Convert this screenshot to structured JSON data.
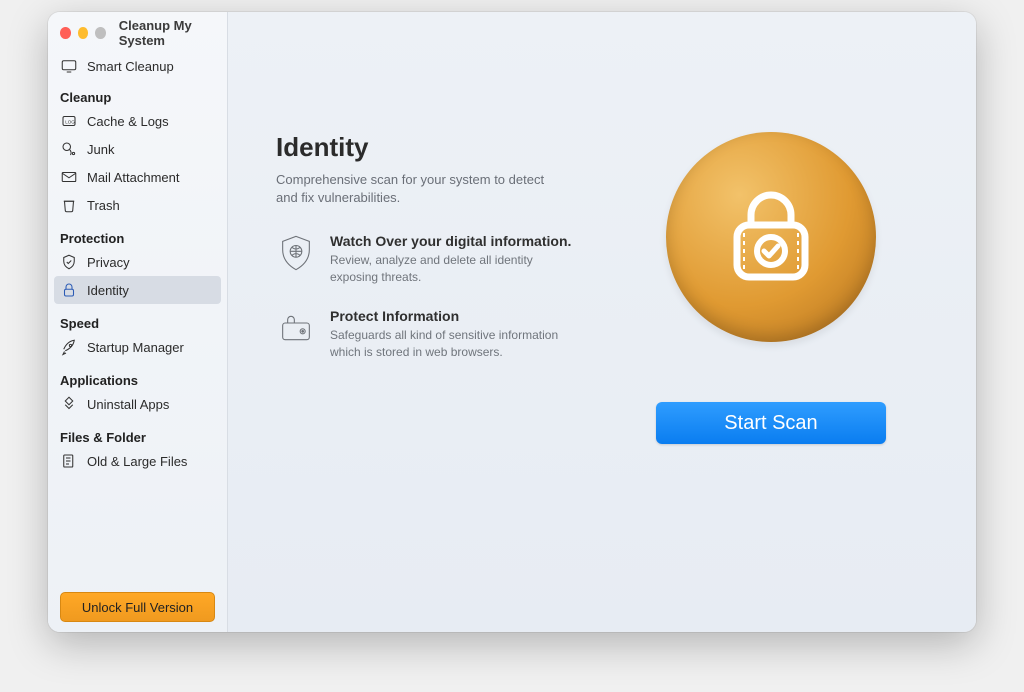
{
  "window": {
    "title": "Cleanup My System"
  },
  "sidebar": {
    "smartCleanup": "Smart Cleanup",
    "sections": {
      "cleanup": {
        "header": "Cleanup",
        "items": {
          "cache": "Cache & Logs",
          "junk": "Junk",
          "mail": "Mail Attachment",
          "trash": "Trash"
        }
      },
      "protection": {
        "header": "Protection",
        "items": {
          "privacy": "Privacy",
          "identity": "Identity"
        }
      },
      "speed": {
        "header": "Speed",
        "items": {
          "startup": "Startup Manager"
        }
      },
      "applications": {
        "header": "Applications",
        "items": {
          "uninstall": "Uninstall Apps"
        }
      },
      "files": {
        "header": "Files & Folder",
        "items": {
          "oldLarge": "Old & Large Files"
        }
      }
    },
    "unlock": "Unlock Full Version"
  },
  "main": {
    "title": "Identity",
    "subtitle": "Comprehensive scan for your system to detect and fix vulnerabilities.",
    "features": [
      {
        "title": "Watch Over your digital information.",
        "desc": "Review, analyze and delete all identity exposing threats."
      },
      {
        "title": "Protect Information",
        "desc": "Safeguards all kind of sensitive information which is stored in web browsers."
      }
    ],
    "scanButton": "Start Scan"
  }
}
